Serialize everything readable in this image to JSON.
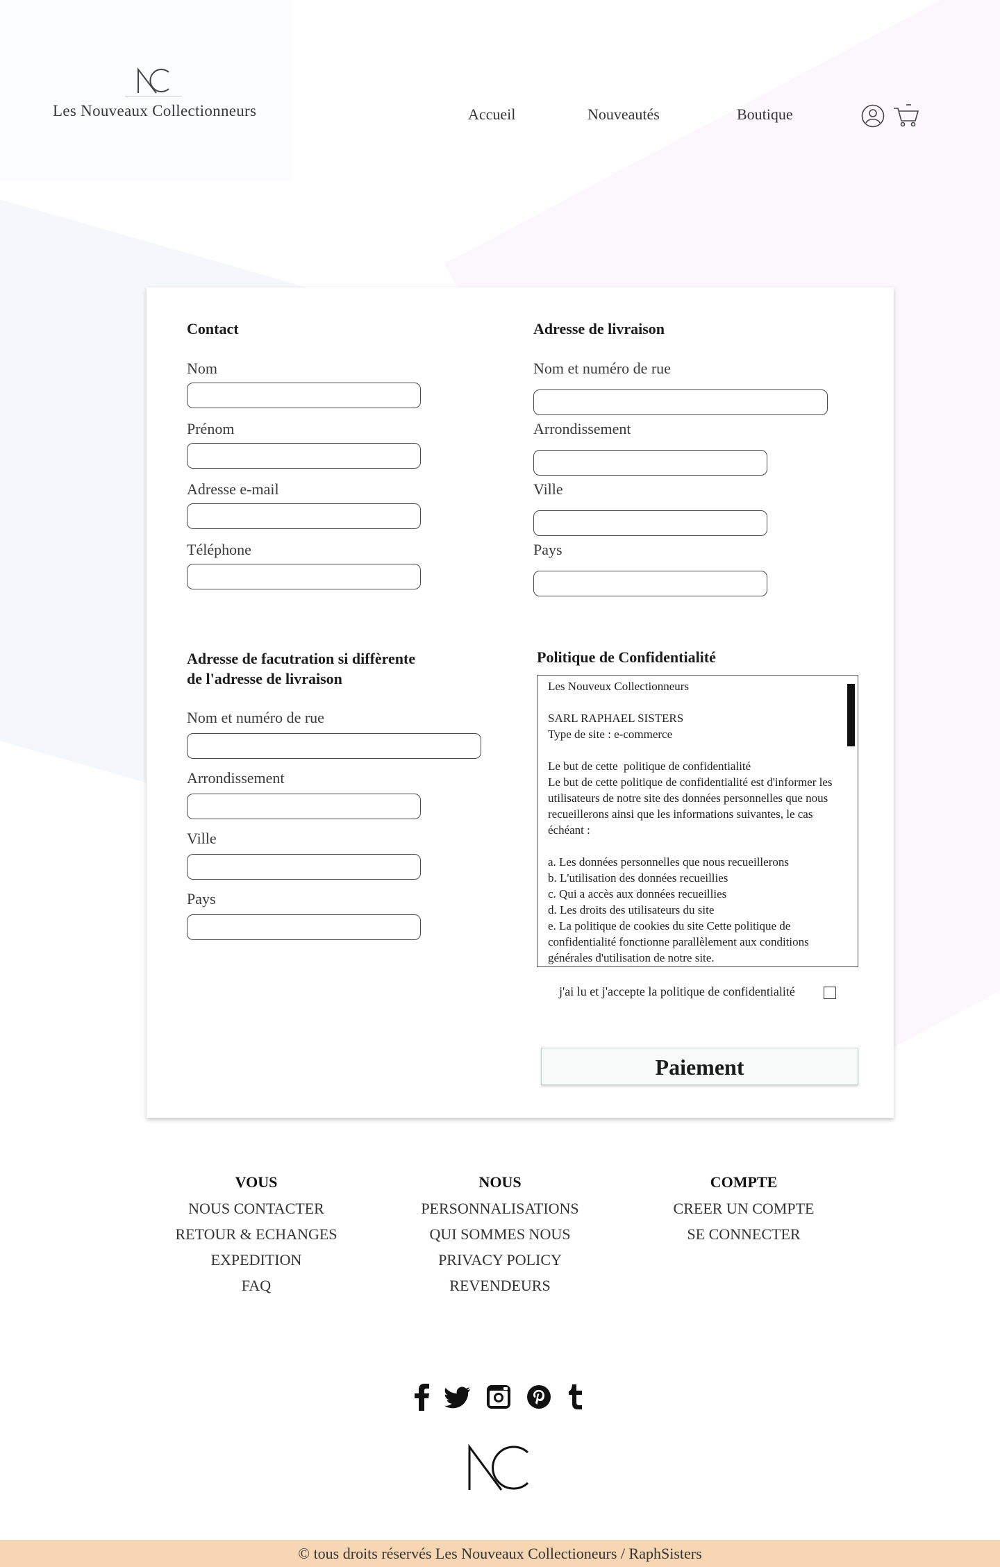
{
  "header": {
    "brand": "Les Nouveaux Collectionneurs",
    "nav": [
      "Accueil",
      "Nouveautés",
      "Boutique"
    ]
  },
  "contact": {
    "title": "Contact",
    "fields": [
      "Nom",
      "Prénom",
      "Adresse e-mail",
      "Téléphone"
    ]
  },
  "shipping": {
    "title": "Adresse de livraison",
    "fields": [
      "Nom et numéro de rue",
      "Arrondissement",
      "Ville",
      "Pays"
    ]
  },
  "billing": {
    "title_line1": "Adresse de facutration si diffèrente",
    "title_line2": "de l'adresse de livraison",
    "fields": [
      "Nom et numéro de rue",
      "Arrondissement",
      "Ville",
      "Pays"
    ]
  },
  "policy": {
    "title": "Politique de Confidentialité",
    "text": "Les Nouveux Collectionneurs\n\nSARL RAPHAEL SISTERS\nType de site : e-commerce\n\nLe but de cette  politique de confidentialité\nLe but de cette politique de confidentialité est d'informer les utilisateurs de notre site des données personnelles que nous recueillerons ainsi que les informations suivantes, le cas échéant :\n\na. Les données personnelles que nous recueillerons\nb. L'utilisation des données recueillies\nc. Qui a accès aux données recueillies\nd. Les droits des utilisateurs du site\ne. La politique de cookies du site Cette politique de confidentialité fonctionne parallèlement aux conditions générales d'utilisation de notre site.",
    "accept_label": "j'ai lu et j'accepte la politique de confidentialité",
    "accept_checked": false
  },
  "pay_button": "Paiement",
  "footer": {
    "columns": [
      {
        "heading": "VOUS",
        "links": [
          "NOUS CONTACTER",
          "RETOUR & ECHANGES",
          "EXPEDITION",
          "FAQ"
        ]
      },
      {
        "heading": "NOUS",
        "links": [
          "PERSONNALISATIONS",
          "QUI SOMMES NOUS",
          "PRIVACY POLICY",
          "REVENDEURS"
        ]
      },
      {
        "heading": "COMPTE",
        "links": [
          "CREER UN COMPTE",
          "SE CONNECTER"
        ]
      }
    ],
    "social_icons": [
      "facebook-icon",
      "twitter-icon",
      "instagram-icon",
      "pinterest-icon",
      "tumblr-icon"
    ],
    "copyright": "© tous droits réservés Les Nouveaux Collectioneurs / RaphSisters"
  },
  "colors": {
    "copyright_bar": "#f7d6b3",
    "button_bg": "#f6faf9"
  }
}
